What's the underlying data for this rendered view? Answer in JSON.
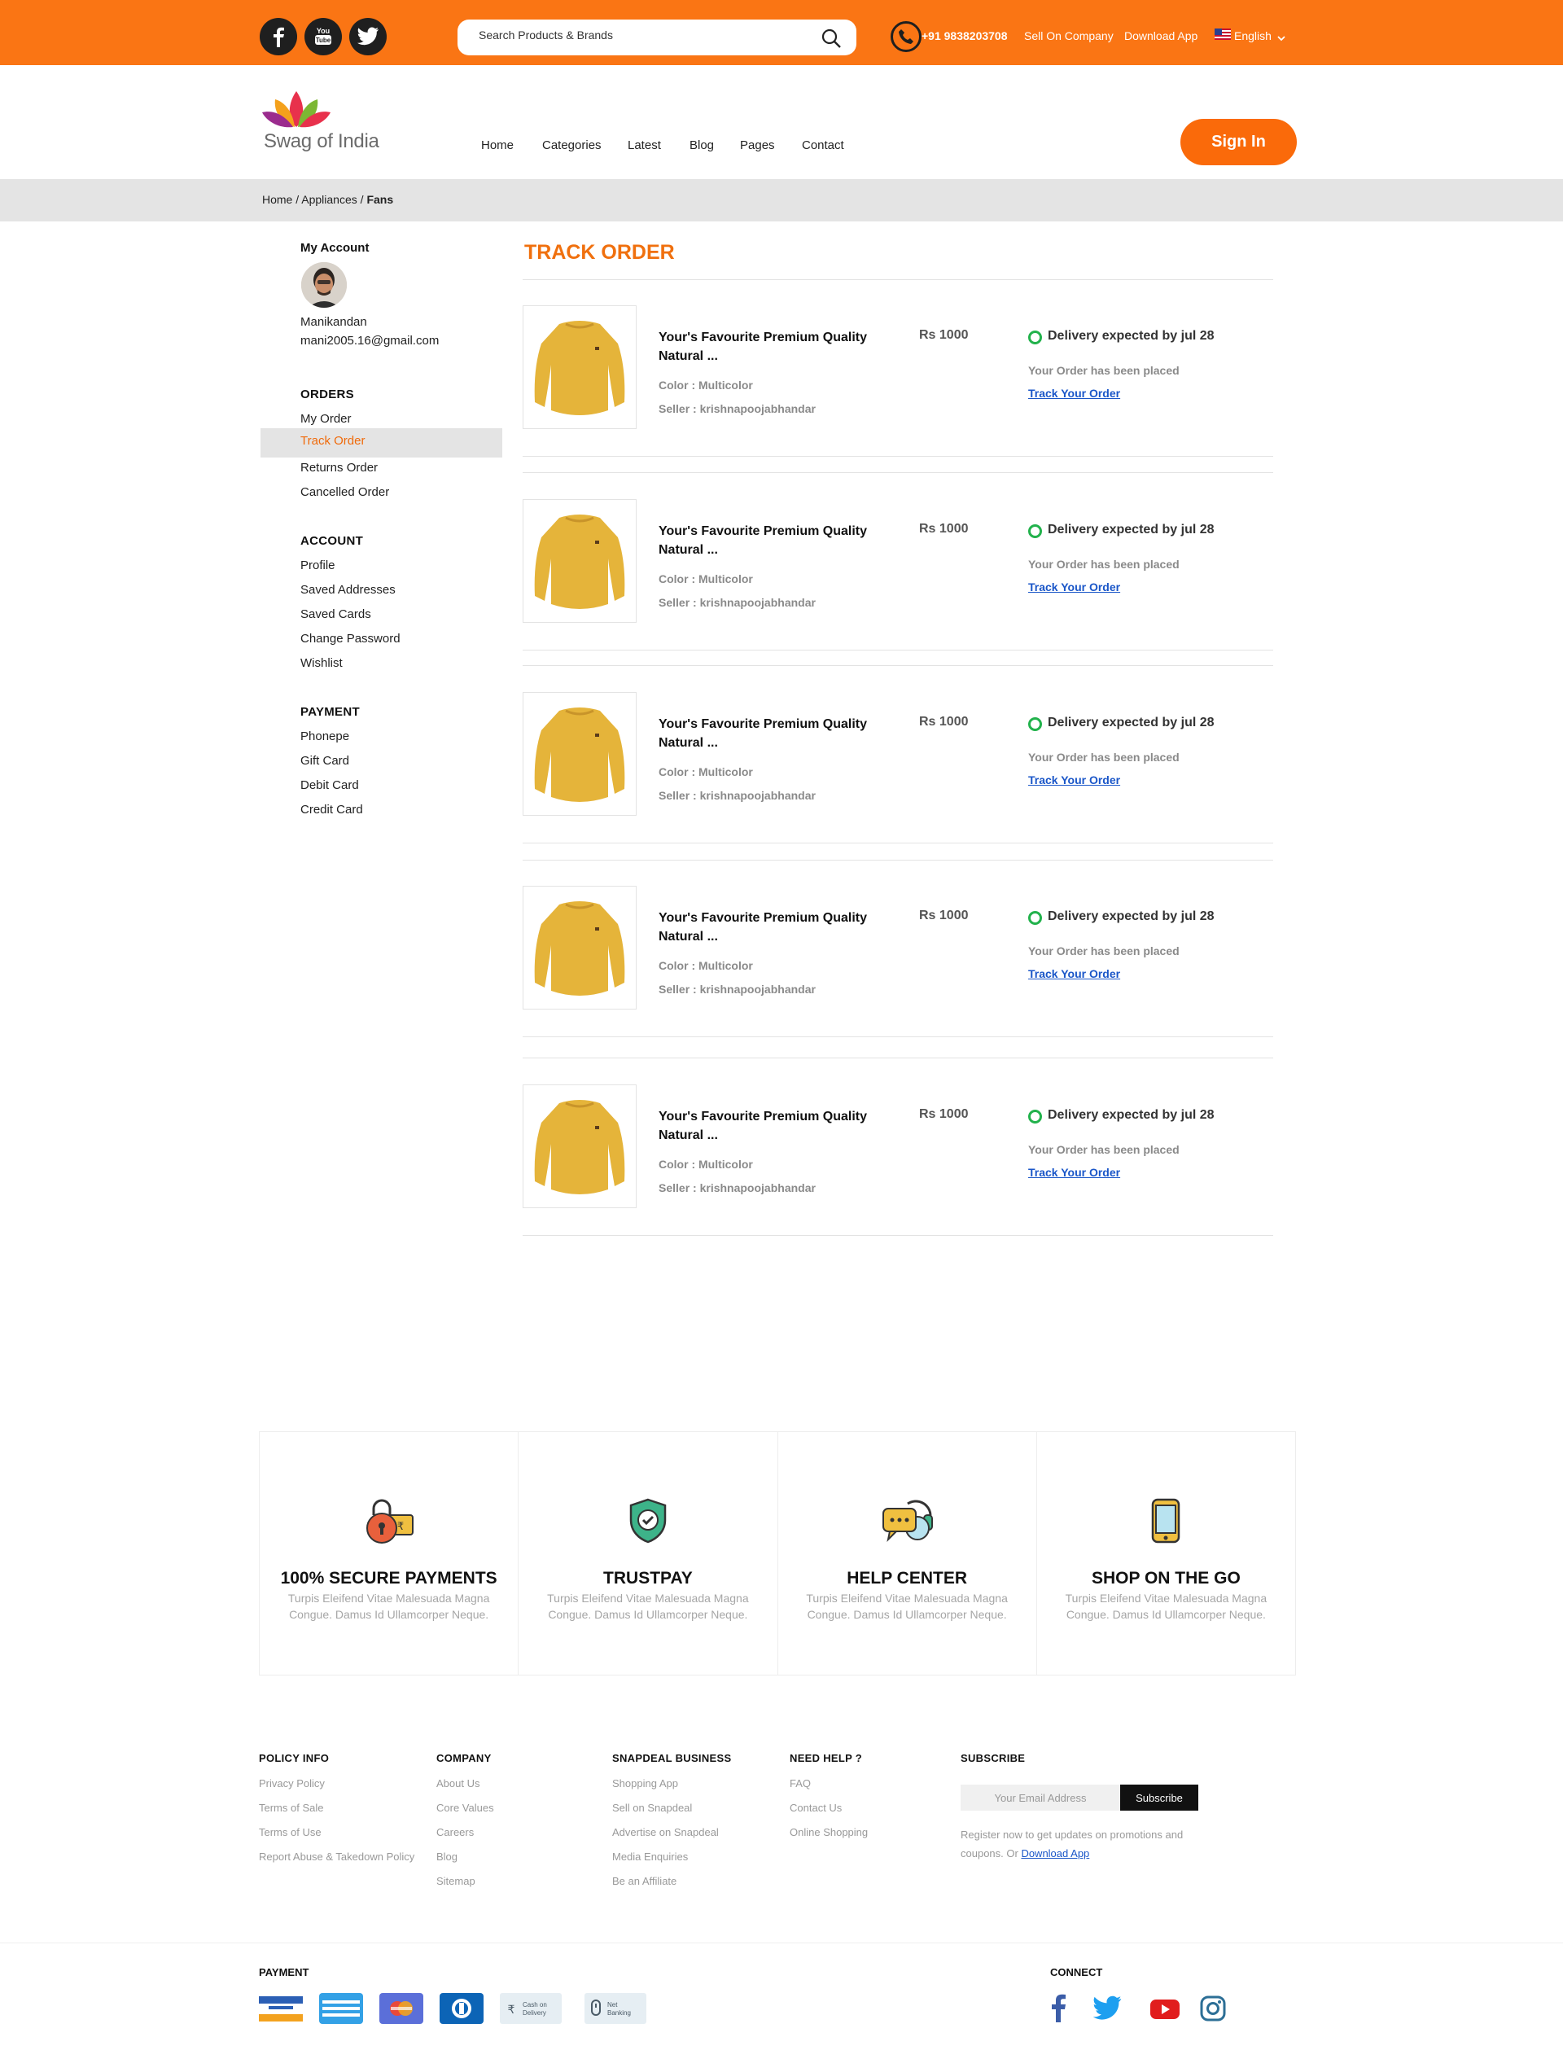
{
  "topbar": {
    "search_placeholder": "Search Products & Brands",
    "phone": "+91 9838203708",
    "sell": "Sell On Company",
    "download": "Download App",
    "language": "English"
  },
  "header": {
    "logo_text": "Swag of India",
    "nav": [
      "Home",
      "Categories",
      "Latest",
      "Blog",
      "Pages",
      "Contact"
    ],
    "signin": "Sign In"
  },
  "breadcrumb": {
    "home": "Home",
    "sep": " / ",
    "mid": "Appliances",
    "current": "Fans"
  },
  "sidebar": {
    "title": "My Account",
    "name": "Manikandan",
    "email": "mani2005.16@gmail.com",
    "orders_head": "ORDERS",
    "orders": [
      "My Order",
      "Track Order",
      "Returns Order",
      "Cancelled Order"
    ],
    "account_head": "ACCOUNT",
    "account": [
      "Profile",
      "Saved Addresses",
      "Saved Cards",
      "Change Password",
      "Wishlist"
    ],
    "payment_head": "PAYMENT",
    "payment": [
      "Phonepe",
      "Gift Card",
      "Debit Card",
      "Credit Card"
    ]
  },
  "main": {
    "title": "TRACK ORDER",
    "orders": [
      {
        "title": "Your's Favourite Premium Quality Natural ...",
        "color": "Color : Multicolor",
        "seller": "Seller : krishnapoojabhandar",
        "price": "Rs 1000",
        "delivery": "Delivery expected by jul 28",
        "status": "Your Order has been placed",
        "track": "Track Your Order"
      },
      {
        "title": "Your's Favourite Premium Quality Natural ...",
        "color": "Color : Multicolor",
        "seller": "Seller : krishnapoojabhandar",
        "price": "Rs 1000",
        "delivery": "Delivery expected by jul 28",
        "status": "Your Order has been placed",
        "track": "Track Your Order"
      },
      {
        "title": "Your's Favourite Premium Quality Natural ...",
        "color": "Color : Multicolor",
        "seller": "Seller : krishnapoojabhandar",
        "price": "Rs 1000",
        "delivery": "Delivery expected by jul 28",
        "status": "Your Order has been placed",
        "track": "Track Your Order"
      },
      {
        "title": "Your's Favourite Premium Quality Natural ...",
        "color": "Color : Multicolor",
        "seller": "Seller : krishnapoojabhandar",
        "price": "Rs 1000",
        "delivery": "Delivery expected by jul 28",
        "status": "Your Order has been placed",
        "track": "Track Your Order"
      },
      {
        "title": "Your's Favourite Premium Quality Natural ...",
        "color": "Color : Multicolor",
        "seller": "Seller : krishnapoojabhandar",
        "price": "Rs 1000",
        "delivery": "Delivery expected by jul 28",
        "status": "Your Order has been placed",
        "track": "Track Your Order"
      }
    ]
  },
  "features": [
    {
      "title": "100% SECURE PAYMENTS",
      "text": "Turpis Eleifend Vitae Malesuada Magna Congue. Damus Id Ullamcorper Neque.",
      "icon": "secure-lock-icon"
    },
    {
      "title": "TRUSTPAY",
      "text": "Turpis Eleifend Vitae Malesuada Magna Congue. Damus Id Ullamcorper Neque.",
      "icon": "shield-check-icon"
    },
    {
      "title": "HELP CENTER",
      "text": "Turpis Eleifend Vitae Malesuada Magna Congue. Damus Id Ullamcorper Neque.",
      "icon": "chat-headset-icon"
    },
    {
      "title": "SHOP ON THE GO",
      "text": "Turpis Eleifend Vitae Malesuada Magna Congue. Damus Id Ullamcorper Neque.",
      "icon": "mobile-phone-icon"
    }
  ],
  "footer": {
    "policy": {
      "title": "POLICY INFO",
      "items": [
        "Privacy Policy",
        "Terms of Sale",
        "Terms of Use",
        "Report Abuse & Takedown Policy"
      ]
    },
    "company": {
      "title": "COMPANY",
      "items": [
        "About Us",
        "Core Values",
        "Careers",
        "Blog",
        "Sitemap"
      ]
    },
    "business": {
      "title": "SNAPDEAL BUSINESS",
      "items": [
        "Shopping App",
        "Sell on Snapdeal",
        "Advertise on Snapdeal",
        "Media Enquiries",
        "Be an Affiliate"
      ]
    },
    "help": {
      "title": "NEED HELP ?",
      "items": [
        "FAQ",
        "Contact Us",
        "Online Shopping"
      ]
    },
    "subscribe": {
      "title": "SUBSCRIBE",
      "placeholder": "Your Email Address",
      "button": "Subscribe",
      "note": "Register now to get updates on promotions and coupons. Or ",
      "link": "Download App"
    },
    "payment_title": "PAYMENT",
    "payment_cash": "Cash on Delivery",
    "payment_net": "Net Banking",
    "connect_title": "CONNECT"
  },
  "colors": {
    "brand": "#fa7514",
    "accent": "#f0700e",
    "link": "#1a56c8",
    "success": "#22b24c"
  }
}
